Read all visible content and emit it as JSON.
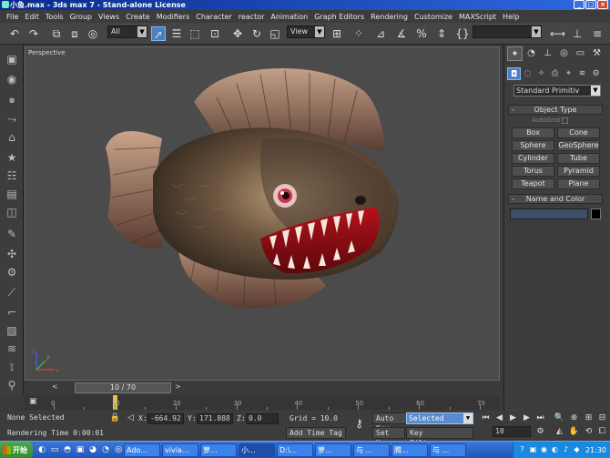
{
  "window": {
    "title": "小鱼.max - 3ds max 7 - Stand-alone License",
    "controls": [
      "_",
      "□",
      "×"
    ]
  },
  "menu": [
    "File",
    "Edit",
    "Tools",
    "Group",
    "Views",
    "Create",
    "Modifiers",
    "Character",
    "reactor",
    "Animation",
    "Graph Editors",
    "Rendering",
    "Customize",
    "MAXScript",
    "Help"
  ],
  "toolbar": {
    "selection_filter": "All",
    "ref_coord": "View",
    "named_selection": ""
  },
  "viewport": {
    "label": "Perspective",
    "axis_labels": [
      "x",
      "y",
      "z"
    ]
  },
  "timeslider": {
    "frame_label": "10 / 70",
    "left_arrow": "<",
    "right_arrow": ">"
  },
  "trackbar": {
    "ticks": [
      "0",
      "10",
      "20",
      "30",
      "40",
      "50",
      "60",
      "70"
    ],
    "key_frame": 10
  },
  "status": {
    "selection": "None Selected",
    "render_time": "Rendering Time  0:00:01",
    "x_label": "X:",
    "x_value": "-664.92",
    "y_label": "Y:",
    "y_value": "171.888",
    "z_label": "Z:",
    "z_value": "0.0",
    "grid": "Grid = 10.0",
    "add_time_tag": "Add Time Tag",
    "auto_key": "Auto Key",
    "selected": "Selected",
    "set_key": "Set Key",
    "key_filters": "Key Filters...",
    "current_frame": "10"
  },
  "panel": {
    "category": "Standard Primitiv",
    "object_type_header": "Object Type",
    "autogrid": "AutoGrid",
    "buttons": [
      "Box",
      "Cone",
      "Sphere",
      "GeoSphere",
      "Cylinder",
      "Tube",
      "Torus",
      "Pyramid",
      "Teapot",
      "Plane"
    ],
    "name_color_header": "Name and Color",
    "collapse_symbol": "-"
  },
  "taskbar": {
    "start": "开始",
    "tasks": [
      "Ado...",
      "vivia...",
      "萝...",
      "小...",
      "D:\\...",
      "萝...",
      "与 ...",
      "腾...",
      "与 ..."
    ],
    "clock": "21:30"
  },
  "colors": {
    "title_start": "#0a2a8c",
    "title_end": "#2e6ae0",
    "selection_blue": "#4a7fc7",
    "key_marker": "#e3c23d",
    "taskbar": "#2356b8"
  }
}
